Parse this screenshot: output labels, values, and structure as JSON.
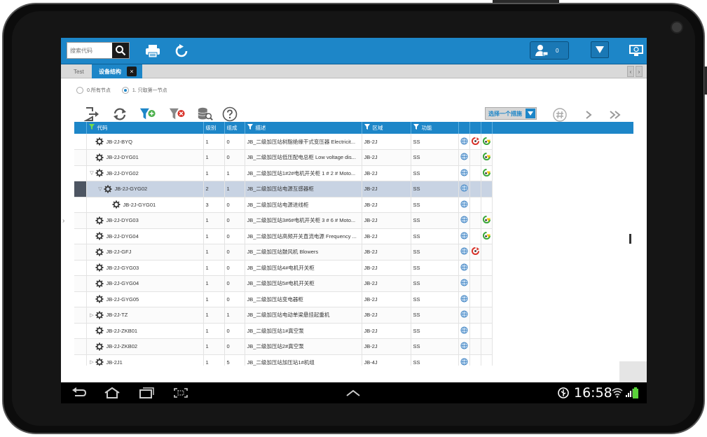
{
  "toolbar": {
    "search_placeholder": "搜索代码",
    "user_count": "0"
  },
  "tabs": [
    {
      "label": "Test",
      "active": false
    },
    {
      "label": "设备结构",
      "active": true
    }
  ],
  "tab_close": "×",
  "radio_options": [
    {
      "label": "0.所有节点",
      "checked": false
    },
    {
      "label": "1. 只取第一节点",
      "checked": true
    }
  ],
  "select_label": "选择一个措施",
  "columns": [
    "代码",
    "级别",
    "组成",
    "描述",
    "区域",
    "功能"
  ],
  "rows": [
    {
      "expander": "",
      "indent": 0,
      "code": "JB-2J-BYQ",
      "level": "1",
      "comp": "0",
      "desc": "JB_二级加压站树脂绝缘干式变压器 Electricit...",
      "area": "JB-2J",
      "func": "SS",
      "icons": [
        "globe",
        "red",
        "green"
      ],
      "selected": false
    },
    {
      "expander": "",
      "indent": 0,
      "code": "JB-2J-DYG01",
      "level": "1",
      "comp": "0",
      "desc": "JB_二级加压站低压配电总柜 Low voltage dis...",
      "area": "JB-2J",
      "func": "SS",
      "icons": [
        "globe",
        "",
        "green"
      ],
      "selected": false
    },
    {
      "expander": "▽",
      "indent": 0,
      "code": "JB-2J-DYG02",
      "level": "1",
      "comp": "1",
      "desc": "JB_二级加压站1#2#电机开关柜 1 # 2 # Moto...",
      "area": "JB-2J",
      "func": "SS",
      "icons": [
        "globe",
        "",
        "green"
      ],
      "selected": false
    },
    {
      "expander": "▽",
      "indent": 1,
      "code": "JB-2J-GYG02",
      "level": "2",
      "comp": "1",
      "desc": "JB_二级加压站电源互感器柜",
      "area": "JB-2J",
      "func": "SS",
      "icons": [
        "globe",
        "",
        ""
      ],
      "selected": true
    },
    {
      "expander": "",
      "indent": 2,
      "code": "JB-2J-GYG01",
      "level": "3",
      "comp": "0",
      "desc": "JB_二级加压站电源进线柜",
      "area": "JB-2J",
      "func": "SS",
      "icons": [
        "globe",
        "",
        ""
      ],
      "selected": false
    },
    {
      "expander": "",
      "indent": 0,
      "code": "JB-2J-DYG03",
      "level": "1",
      "comp": "0",
      "desc": "JB_二级加压站3#6#电机开关柜 3 # 6 # Moto...",
      "area": "JB-2J",
      "func": "SS",
      "icons": [
        "globe",
        "",
        "green"
      ],
      "selected": false
    },
    {
      "expander": "",
      "indent": 0,
      "code": "JB-2J-DYG04",
      "level": "1",
      "comp": "0",
      "desc": "JB_二级加压站高频开关直流电源 Frequency ...",
      "area": "JB-2J",
      "func": "SS",
      "icons": [
        "globe",
        "",
        "green"
      ],
      "selected": false
    },
    {
      "expander": "",
      "indent": 0,
      "code": "JB-2J-GFJ",
      "level": "1",
      "comp": "0",
      "desc": "JB_二级加压站鼓风机 Blowers",
      "area": "JB-2J",
      "func": "SS",
      "icons": [
        "globe",
        "red",
        ""
      ],
      "selected": false
    },
    {
      "expander": "",
      "indent": 0,
      "code": "JB-2J-GYG03",
      "level": "1",
      "comp": "0",
      "desc": "JB_二级加压站4#电机开关柜",
      "area": "JB-2J",
      "func": "SS",
      "icons": [
        "globe",
        "",
        ""
      ],
      "selected": false
    },
    {
      "expander": "",
      "indent": 0,
      "code": "JB-2J-GYG04",
      "level": "1",
      "comp": "0",
      "desc": "JB_二级加压站5#电机开关柜",
      "area": "JB-2J",
      "func": "SS",
      "icons": [
        "globe",
        "",
        ""
      ],
      "selected": false
    },
    {
      "expander": "",
      "indent": 0,
      "code": "JB-2J-GYG05",
      "level": "1",
      "comp": "0",
      "desc": "JB_二级加压站变电器柜",
      "area": "JB-2J",
      "func": "SS",
      "icons": [
        "globe",
        "",
        ""
      ],
      "selected": false
    },
    {
      "expander": "▷",
      "indent": 0,
      "code": "JB-2J-TZ",
      "level": "1",
      "comp": "1",
      "desc": "JB_二级加压站电动单梁悬挂起重机",
      "area": "JB-2J",
      "func": "SS",
      "icons": [
        "globe",
        "",
        ""
      ],
      "selected": false
    },
    {
      "expander": "",
      "indent": 0,
      "code": "JB-2J-ZKB01",
      "level": "1",
      "comp": "0",
      "desc": "JB_二级加压站1#真空泵",
      "area": "JB-2J",
      "func": "SS",
      "icons": [
        "globe",
        "",
        ""
      ],
      "selected": false
    },
    {
      "expander": "",
      "indent": 0,
      "code": "JB-2J-ZKB02",
      "level": "1",
      "comp": "0",
      "desc": "JB_二级加压站2#真空泵",
      "area": "JB-2J",
      "func": "SS",
      "icons": [
        "globe",
        "",
        ""
      ],
      "selected": false
    },
    {
      "expander": "▷",
      "indent": 0,
      "code": "JB-2J1",
      "level": "1",
      "comp": "5",
      "desc": "JB_二级加压站加压站1#机组",
      "area": "JB-4J",
      "func": "SS",
      "icons": [
        "globe",
        "",
        ""
      ],
      "selected": false
    }
  ],
  "status": {
    "time": "16:58"
  },
  "colors": {
    "accent": "#1d86c8",
    "selected_row": "#c8d3e3"
  }
}
